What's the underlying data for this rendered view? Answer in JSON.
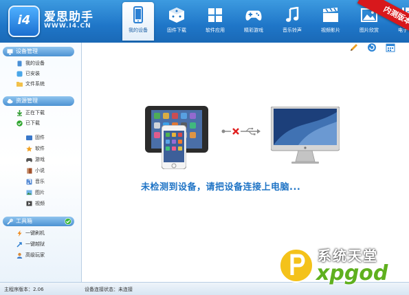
{
  "app": {
    "logo_text": "i4",
    "title": "爱思助手",
    "url": "WWW.I4.CN",
    "badge": "内测版本"
  },
  "nav": [
    {
      "label": "我的设备",
      "icon": "phone-icon",
      "active": true
    },
    {
      "label": "固件下载",
      "icon": "dice-box-icon",
      "active": false
    },
    {
      "label": "软件应用",
      "icon": "apps-grid-icon",
      "active": false
    },
    {
      "label": "精彩游戏",
      "icon": "gamepad-icon",
      "active": false
    },
    {
      "label": "音乐铃声",
      "icon": "music-note-icon",
      "active": false
    },
    {
      "label": "视频影片",
      "icon": "clapper-icon",
      "active": false
    },
    {
      "label": "图片欣赏",
      "icon": "picture-icon",
      "active": false
    },
    {
      "label": "电子书籍",
      "icon": "book-icon",
      "active": false
    }
  ],
  "sidebar": {
    "device": {
      "header": "设备管理",
      "items": [
        "我的设备",
        "已安装",
        "文件系统"
      ]
    },
    "resources": {
      "header": "资源管理",
      "items": [
        "正在下载",
        "已下载"
      ],
      "sub_items": [
        "固件",
        "软件",
        "游戏",
        "小说",
        "音乐",
        "图片",
        "视频"
      ]
    },
    "tools": {
      "header": "工具箱",
      "items": [
        "一键刷机",
        "一键越狱",
        "高级玩家"
      ]
    }
  },
  "main": {
    "message": "未检测到设备，请把设备连接上电脑..."
  },
  "status": {
    "version_label": "主程序版本：2.06",
    "connection_label": "设备连接状态：未连接"
  },
  "watermark": {
    "line1": "系统天堂",
    "line2": "xpgod"
  },
  "colors": {
    "nav_blue": "#1f76c8",
    "message_blue": "#1e73c5",
    "badge_red": "#d8181c"
  }
}
